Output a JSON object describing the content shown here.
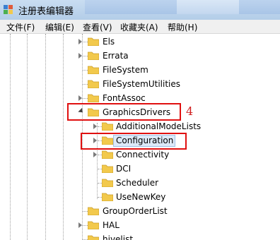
{
  "window": {
    "title": "注册表编辑器"
  },
  "menu": {
    "file": "文件(F)",
    "edit": "编辑(E)",
    "view": "查看(V)",
    "favorites": "收藏夹(A)",
    "help": "帮助(H)"
  },
  "tree": {
    "items": [
      {
        "label": "Els"
      },
      {
        "label": "Errata"
      },
      {
        "label": "FileSystem"
      },
      {
        "label": "FileSystemUtilities"
      },
      {
        "label": "FontAssoc"
      },
      {
        "label": "GraphicsDrivers"
      },
      {
        "label": "AdditionalModeLists"
      },
      {
        "label": "Configuration"
      },
      {
        "label": "Connectivity"
      },
      {
        "label": "DCI"
      },
      {
        "label": "Scheduler"
      },
      {
        "label": "UseNewKey"
      },
      {
        "label": "GroupOrderList"
      },
      {
        "label": "HAL"
      },
      {
        "label": "hivelist"
      }
    ]
  },
  "annotation": {
    "step_number": "4"
  },
  "colors": {
    "highlight_box": "#e01010",
    "folder": "#f2c94c",
    "annotation_text": "#d02020"
  }
}
